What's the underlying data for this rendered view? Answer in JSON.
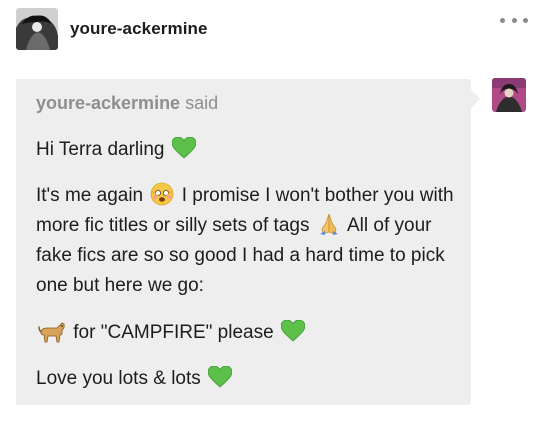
{
  "post": {
    "author": "youre-ackermine",
    "menu_icon": "more-horizontal-icon"
  },
  "ask": {
    "asker": "youre-ackermine",
    "said_word": "said",
    "greeting": "Hi Terra darling",
    "para1_a": "It's me again",
    "para1_b": "I promise I won't bother you with more fic titles or silly sets of tags",
    "para1_c": "All of your fake fics are so so good I had a hard time to pick one but here we go:",
    "request_a": "for \"CAMPFIRE\" please",
    "closing": "Love you lots & lots"
  },
  "icons": {
    "heart": "green-heart-icon",
    "shy": "flushed-face-icon",
    "pray": "folded-hands-icon",
    "dog": "dog-icon"
  },
  "colors": {
    "bubble": "#eeeeee",
    "muted_text": "#8f8f8f",
    "heart": "#5cc04b"
  }
}
